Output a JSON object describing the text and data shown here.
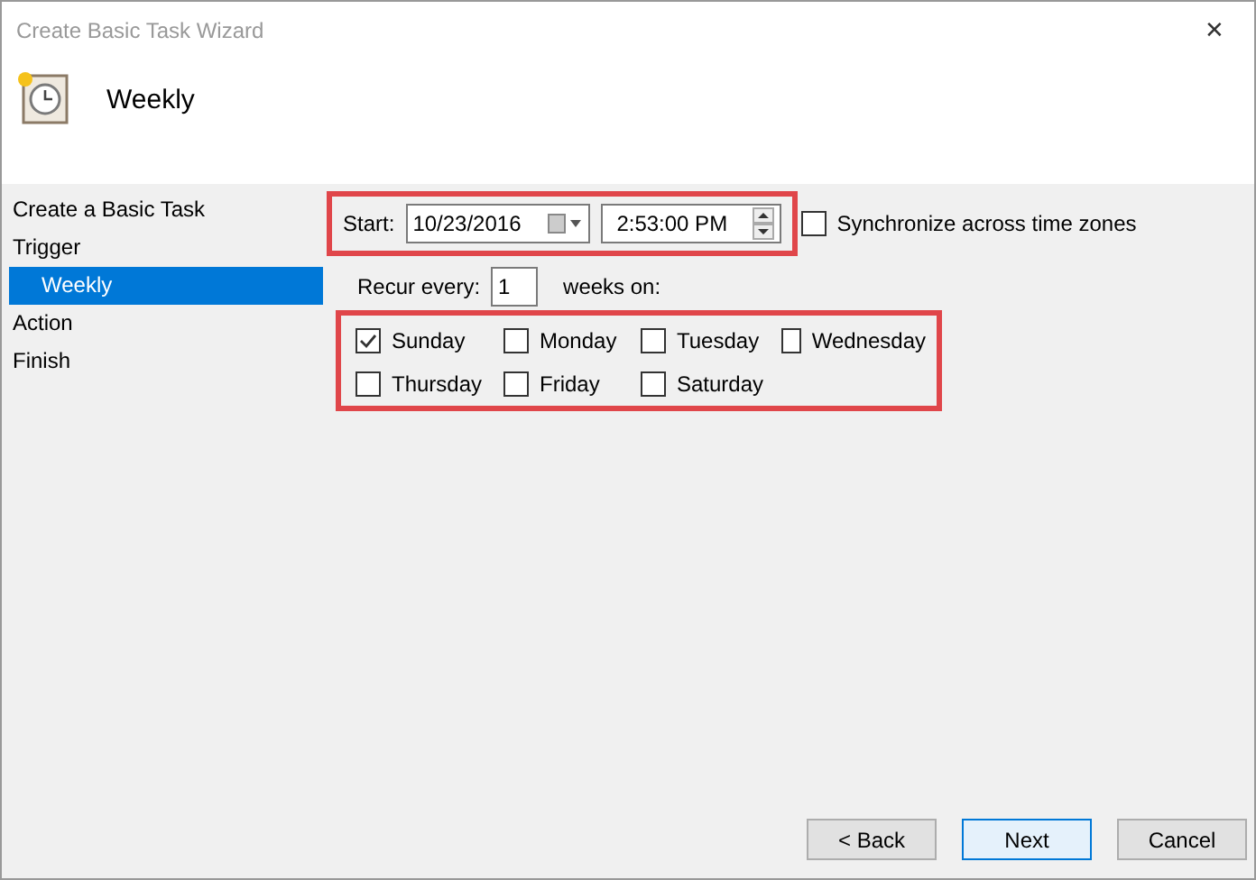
{
  "window": {
    "title": "Create Basic Task Wizard",
    "close": "✕"
  },
  "header": {
    "title": "Weekly"
  },
  "sidebar": {
    "items": [
      {
        "label": "Create a Basic Task",
        "selected": false
      },
      {
        "label": "Trigger",
        "selected": false,
        "children": [
          {
            "label": "Weekly",
            "selected": true
          }
        ]
      },
      {
        "label": "Action",
        "selected": false
      },
      {
        "label": "Finish",
        "selected": false
      }
    ]
  },
  "start": {
    "label": "Start:",
    "date": "10/23/2016",
    "time": "2:53:00 PM",
    "highlighted": true
  },
  "sync": {
    "label": "Synchronize across time zones",
    "checked": false
  },
  "recur": {
    "label": "Recur every:",
    "value": "1",
    "suffix": "weeks on:"
  },
  "days": {
    "highlighted": true,
    "items": [
      {
        "label": "Sunday",
        "checked": true
      },
      {
        "label": "Monday",
        "checked": false
      },
      {
        "label": "Tuesday",
        "checked": false
      },
      {
        "label": "Wednesday",
        "checked": false
      },
      {
        "label": "Thursday",
        "checked": false
      },
      {
        "label": "Friday",
        "checked": false
      },
      {
        "label": "Saturday",
        "checked": false
      }
    ]
  },
  "buttons": [
    {
      "label": "< Back",
      "kind": "normal"
    },
    {
      "label": "Next",
      "kind": "default"
    },
    {
      "label": "Cancel",
      "kind": "normal"
    }
  ]
}
